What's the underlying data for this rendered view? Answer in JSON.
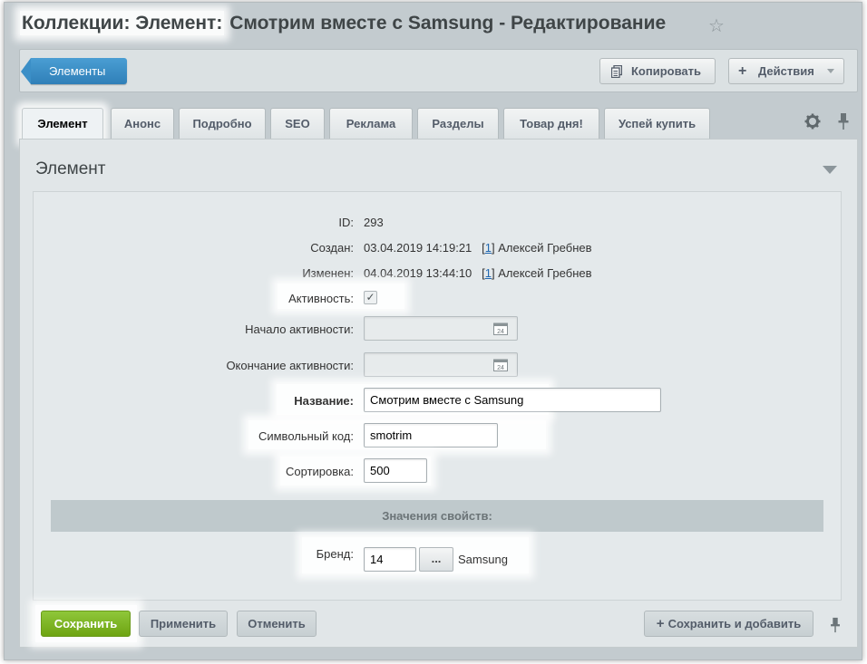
{
  "header": {
    "title_highlighted": "Коллекции: Элемент:",
    "title_rest": "Смотрим вместе с Samsung - Редактирование"
  },
  "toolbar": {
    "back_label": "Элементы",
    "copy_label": "Копировать",
    "actions_label": "Действия"
  },
  "tabs": [
    {
      "label": "Элемент",
      "active": true
    },
    {
      "label": "Анонс"
    },
    {
      "label": "Подробно"
    },
    {
      "label": "SEO"
    },
    {
      "label": "Реклама"
    },
    {
      "label": "Разделы"
    },
    {
      "label": "Товар дня!"
    },
    {
      "label": "Успей купить"
    }
  ],
  "panel": {
    "title": "Элемент",
    "fields": {
      "id_label": "ID:",
      "id_value": "293",
      "created_label": "Создан:",
      "created_value": "03.04.2019 14:19:21",
      "created_link": "1",
      "created_by": "Алексей Гребнев",
      "modified_label": "Изменен:",
      "modified_value": "04.04.2019 13:44:10",
      "modified_link": "1",
      "modified_by": "Алексей Гребнев",
      "active_label": "Активность:",
      "active_checked": true,
      "active_from_label": "Начало активности:",
      "active_from_value": "",
      "active_to_label": "Окончание активности:",
      "active_to_value": "",
      "name_label": "Название:",
      "name_value": "Смотрим вместе с Samsung",
      "code_label": "Символьный код:",
      "code_value": "smotrim",
      "sort_label": "Сортировка:",
      "sort_value": "500"
    },
    "properties_header": "Значения свойств:",
    "brand_label": "Бренд:",
    "brand_value": "14",
    "brand_dots": "...",
    "brand_name": "Samsung"
  },
  "footer": {
    "save_label": "Сохранить",
    "apply_label": "Применить",
    "cancel_label": "Отменить",
    "save_add_label": "Сохранить и добавить"
  },
  "colors": {
    "frame_bg": "#c3cbcf",
    "save_green": "#7cb525",
    "back_blue": "#3b8fc7",
    "link_blue": "#2067b0"
  },
  "icons": [
    "star-icon",
    "copy-icon",
    "plus-icon",
    "dropdown-arrow-icon",
    "gear-icon",
    "pin-icon",
    "calendar-icon",
    "checkmark-icon",
    "collapse-arrow-icon"
  ]
}
